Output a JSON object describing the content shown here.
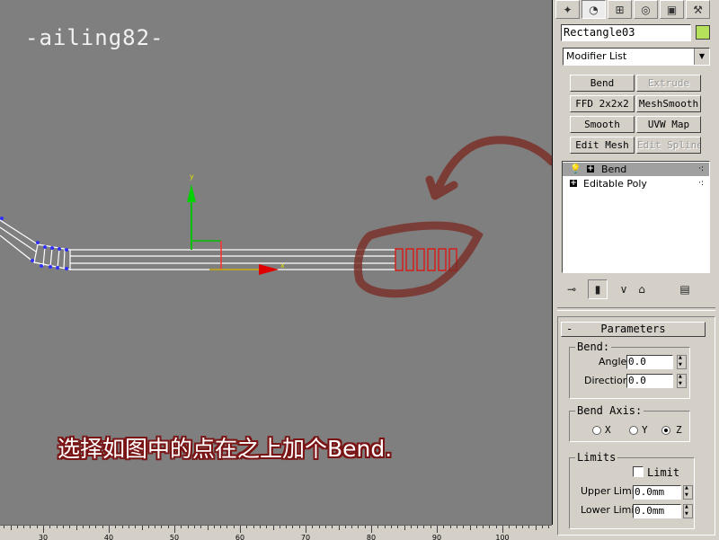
{
  "watermark": "-ailing82-",
  "caption": "选择如图中的点在之上加个Bend.",
  "viewport": {
    "axis_y_label": "y",
    "axis_x_label": "x",
    "ruler_labels": [
      "30",
      "40",
      "50",
      "60",
      "70",
      "80",
      "90",
      "100"
    ]
  },
  "command_panel": {
    "tabs": [
      {
        "name": "create-tab-icon",
        "glyph": "✦"
      },
      {
        "name": "modify-tab-icon",
        "glyph": "◔"
      },
      {
        "name": "hierarchy-tab-icon",
        "glyph": "⊞"
      },
      {
        "name": "motion-tab-icon",
        "glyph": "◎"
      },
      {
        "name": "display-tab-icon",
        "glyph": "▣"
      },
      {
        "name": "utilities-tab-icon",
        "glyph": "⚒"
      }
    ],
    "object_name": "Rectangle03",
    "object_color": "#b4e05a",
    "modifier_list": "Modifier List",
    "modifier_buttons": [
      {
        "label": "Bend",
        "enabled": true
      },
      {
        "label": "Extrude",
        "enabled": false
      },
      {
        "label": "FFD 2x2x2",
        "enabled": true
      },
      {
        "label": "MeshSmooth",
        "enabled": true
      },
      {
        "label": "Smooth",
        "enabled": true
      },
      {
        "label": "UVW Map",
        "enabled": true
      },
      {
        "label": "Edit Mesh",
        "enabled": true
      },
      {
        "label": "Edit Spline",
        "enabled": false
      }
    ],
    "stack": [
      {
        "label": "Bend",
        "selected": true
      },
      {
        "label": "Editable Poly",
        "selected": false
      }
    ],
    "parameters": {
      "title": "Parameters",
      "collapse": "-",
      "bend_group": "Bend:",
      "angle_label": "Angle:",
      "angle_value": "0.0",
      "direction_label": "Direction:",
      "direction_value": "0.0",
      "axis_group": "Bend Axis:",
      "axes": [
        "X",
        "Y",
        "Z"
      ],
      "selected_axis": "Z",
      "limits_group": "Limits",
      "limit_label": "Limit",
      "limit_checked": false,
      "upper_label": "Upper Limit:",
      "upper_value": "0.0mm",
      "lower_label": "Lower Limit:",
      "lower_value": "0.0mm"
    }
  }
}
